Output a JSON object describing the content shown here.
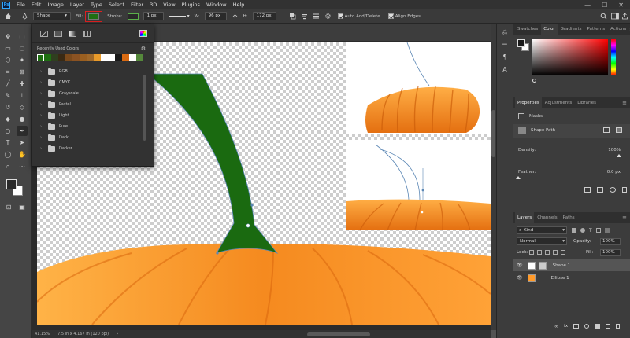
{
  "app": {
    "logo_text": "Ps",
    "menu": [
      "File",
      "Edit",
      "Image",
      "Layer",
      "Type",
      "Select",
      "Filter",
      "3D",
      "View",
      "Plugins",
      "Window",
      "Help"
    ],
    "window_controls": [
      "—",
      "☐",
      "✕"
    ]
  },
  "options_bar": {
    "mode_value": "Shape",
    "fill_label": "Fill:",
    "fill_color": "#1e6f12",
    "stroke_label": "Stroke:",
    "stroke_color": "#5bb04a",
    "stroke_width": "1 px",
    "w_label": "W:",
    "w_value": "96 px",
    "link_icon": "link-icon",
    "h_label": "H:",
    "h_value": "172 px",
    "auto_add_delete_label": "Auto Add/Delete",
    "align_edges_label": "Align Edges",
    "highlight_color": "#e02020"
  },
  "fill_popup": {
    "recently_used_label": "Recently Used Colors",
    "recent_colors": [
      "#1e6f12",
      "#1e6f12",
      "#2f3f1f",
      "#3a2a14",
      "#7b4a1c",
      "#8a5222",
      "#9a5f20",
      "#a0692a",
      "#e89a2a",
      "#ffffff",
      "#ffffff",
      "#1a1a1a",
      "#d86a12",
      "#ffffff",
      "#55883b"
    ],
    "folders": [
      "RGB",
      "CMYK",
      "Grayscale",
      "Pastel",
      "Light",
      "Pure",
      "Dark",
      "Darker"
    ]
  },
  "status_bar": {
    "zoom": "41.15%",
    "doc_size": "7.5 in x 4.167 in (120 ppi)"
  },
  "color_panel": {
    "tabs": [
      "Swatches",
      "Color",
      "Gradients",
      "Patterns",
      "Actions"
    ],
    "active_tab": "Color",
    "hue_color": "#ff0000"
  },
  "properties_panel": {
    "tabs": [
      "Properties",
      "Adjustments",
      "Libraries"
    ],
    "active_tab": "Properties",
    "masks_label": "Masks",
    "shape_path_label": "Shape Path",
    "density_label": "Density:",
    "density_value": "100%",
    "density_level": 1.0,
    "feather_label": "Feather:",
    "feather_value": "0.0 px",
    "feather_level": 0.0
  },
  "layers_panel": {
    "tabs": [
      "Layers",
      "Channels",
      "Paths"
    ],
    "active_tab": "Layers",
    "filter_kind": "Kind",
    "blend_mode": "Normal",
    "opacity_label": "Opacity:",
    "opacity_value": "100%",
    "lock_label": "Lock:",
    "fill_label": "Fill:",
    "fill_value": "100%",
    "layers": [
      {
        "name": "Shape 1",
        "selected": true
      },
      {
        "name": "Ellipse 1",
        "selected": false
      }
    ]
  },
  "colors": {
    "pumpkin_light": "#ffb347",
    "pumpkin_mid": "#f58a1f",
    "pumpkin_dark": "#c95a08",
    "stem": "#1a6a10",
    "path_line": "#5b87b5"
  }
}
